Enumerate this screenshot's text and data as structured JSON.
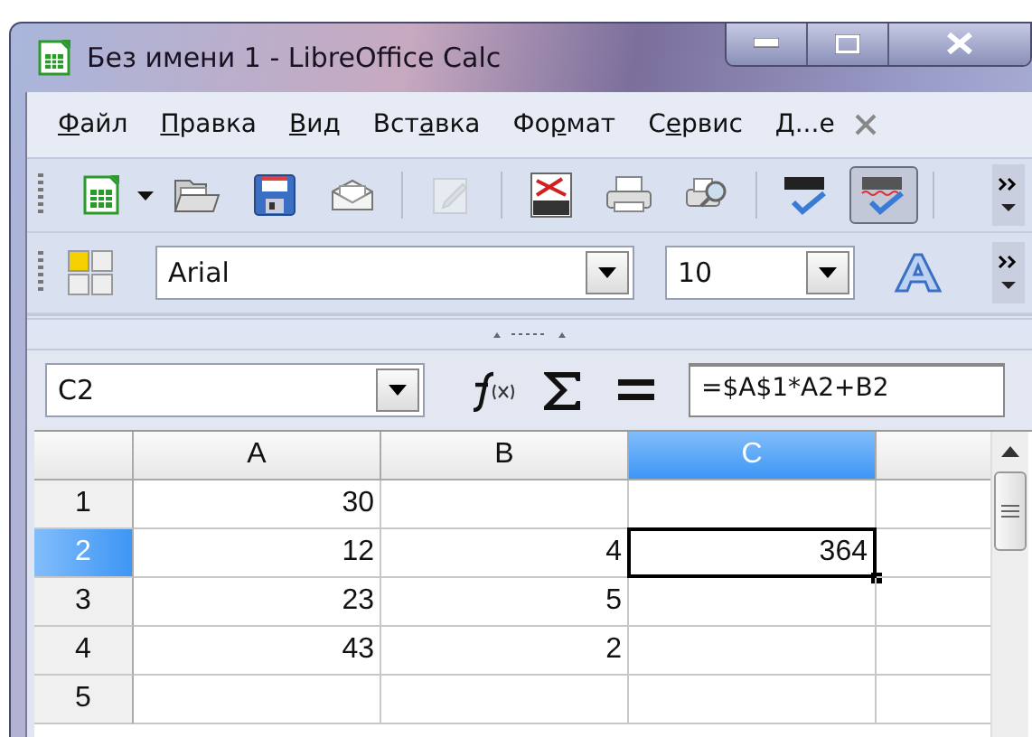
{
  "window": {
    "title": "Без имени 1 - LibreOffice Calc"
  },
  "menu": [
    {
      "accel": "Ф",
      "after": "айл"
    },
    {
      "accel": "П",
      "after": "равка"
    },
    {
      "accel": "В",
      "after": "ид"
    },
    {
      "before": "Вст",
      "accel": "а",
      "after": "вка"
    },
    {
      "before": "Фо",
      "accel": "р",
      "after": "мат"
    },
    {
      "before": "С",
      "accel": "е",
      "after": "рвис"
    },
    {
      "accel": "Д",
      "after": "...е"
    }
  ],
  "standard_toolbar": [
    {
      "kind": "new"
    },
    {
      "kind": "caret"
    },
    {
      "kind": "open"
    },
    {
      "kind": "save"
    },
    {
      "kind": "mail"
    },
    {
      "kind": "sep"
    },
    {
      "kind": "edit",
      "disabled": true
    },
    {
      "kind": "sep"
    },
    {
      "kind": "pdf"
    },
    {
      "kind": "print"
    },
    {
      "kind": "preview"
    },
    {
      "kind": "sep"
    },
    {
      "kind": "spell"
    },
    {
      "kind": "autospell",
      "pressed": true
    },
    {
      "kind": "sep"
    }
  ],
  "format_toolbar": {
    "font_name": "Arial",
    "font_size": "10"
  },
  "formula_bar": {
    "cell_ref": "C2",
    "formula": "=$A$1*A2+B2"
  },
  "sheet": {
    "columns": [
      {
        "label": "A",
        "selected": false
      },
      {
        "label": "B",
        "selected": false
      },
      {
        "label": "C",
        "selected": true
      }
    ],
    "rows": [
      {
        "label": "1",
        "selected": false,
        "cells": [
          {
            "value": "30",
            "active": false
          },
          {
            "active": false
          },
          {
            "active": false
          }
        ]
      },
      {
        "label": "2",
        "selected": true,
        "cells": [
          {
            "value": "12",
            "active": false
          },
          {
            "value": "4",
            "active": false
          },
          {
            "value": "364",
            "active": true
          }
        ]
      },
      {
        "label": "3",
        "selected": false,
        "cells": [
          {
            "value": "23",
            "active": false
          },
          {
            "value": "5",
            "active": false
          },
          {
            "active": false
          }
        ]
      },
      {
        "label": "4",
        "selected": false,
        "cells": [
          {
            "value": "43",
            "active": false
          },
          {
            "value": "2",
            "active": false
          },
          {
            "active": false
          }
        ]
      },
      {
        "label": "5",
        "selected": false,
        "cells": [
          {
            "active": false
          },
          {
            "active": false
          },
          {
            "active": false
          }
        ]
      }
    ]
  }
}
